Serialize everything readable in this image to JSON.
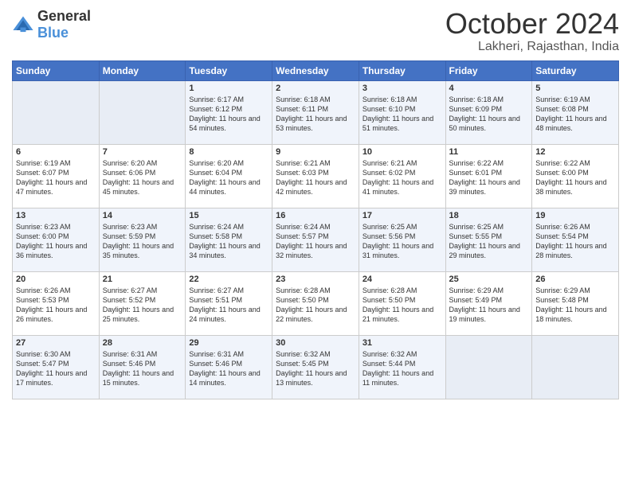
{
  "logo": {
    "general": "General",
    "blue": "Blue"
  },
  "header": {
    "month": "October 2024",
    "location": "Lakheri, Rajasthan, India"
  },
  "weekdays": [
    "Sunday",
    "Monday",
    "Tuesday",
    "Wednesday",
    "Thursday",
    "Friday",
    "Saturday"
  ],
  "weeks": [
    [
      {
        "day": "",
        "sunrise": "",
        "sunset": "",
        "daylight": ""
      },
      {
        "day": "",
        "sunrise": "",
        "sunset": "",
        "daylight": ""
      },
      {
        "day": "1",
        "sunrise": "Sunrise: 6:17 AM",
        "sunset": "Sunset: 6:12 PM",
        "daylight": "Daylight: 11 hours and 54 minutes."
      },
      {
        "day": "2",
        "sunrise": "Sunrise: 6:18 AM",
        "sunset": "Sunset: 6:11 PM",
        "daylight": "Daylight: 11 hours and 53 minutes."
      },
      {
        "day": "3",
        "sunrise": "Sunrise: 6:18 AM",
        "sunset": "Sunset: 6:10 PM",
        "daylight": "Daylight: 11 hours and 51 minutes."
      },
      {
        "day": "4",
        "sunrise": "Sunrise: 6:18 AM",
        "sunset": "Sunset: 6:09 PM",
        "daylight": "Daylight: 11 hours and 50 minutes."
      },
      {
        "day": "5",
        "sunrise": "Sunrise: 6:19 AM",
        "sunset": "Sunset: 6:08 PM",
        "daylight": "Daylight: 11 hours and 48 minutes."
      }
    ],
    [
      {
        "day": "6",
        "sunrise": "Sunrise: 6:19 AM",
        "sunset": "Sunset: 6:07 PM",
        "daylight": "Daylight: 11 hours and 47 minutes."
      },
      {
        "day": "7",
        "sunrise": "Sunrise: 6:20 AM",
        "sunset": "Sunset: 6:06 PM",
        "daylight": "Daylight: 11 hours and 45 minutes."
      },
      {
        "day": "8",
        "sunrise": "Sunrise: 6:20 AM",
        "sunset": "Sunset: 6:04 PM",
        "daylight": "Daylight: 11 hours and 44 minutes."
      },
      {
        "day": "9",
        "sunrise": "Sunrise: 6:21 AM",
        "sunset": "Sunset: 6:03 PM",
        "daylight": "Daylight: 11 hours and 42 minutes."
      },
      {
        "day": "10",
        "sunrise": "Sunrise: 6:21 AM",
        "sunset": "Sunset: 6:02 PM",
        "daylight": "Daylight: 11 hours and 41 minutes."
      },
      {
        "day": "11",
        "sunrise": "Sunrise: 6:22 AM",
        "sunset": "Sunset: 6:01 PM",
        "daylight": "Daylight: 11 hours and 39 minutes."
      },
      {
        "day": "12",
        "sunrise": "Sunrise: 6:22 AM",
        "sunset": "Sunset: 6:00 PM",
        "daylight": "Daylight: 11 hours and 38 minutes."
      }
    ],
    [
      {
        "day": "13",
        "sunrise": "Sunrise: 6:23 AM",
        "sunset": "Sunset: 6:00 PM",
        "daylight": "Daylight: 11 hours and 36 minutes."
      },
      {
        "day": "14",
        "sunrise": "Sunrise: 6:23 AM",
        "sunset": "Sunset: 5:59 PM",
        "daylight": "Daylight: 11 hours and 35 minutes."
      },
      {
        "day": "15",
        "sunrise": "Sunrise: 6:24 AM",
        "sunset": "Sunset: 5:58 PM",
        "daylight": "Daylight: 11 hours and 34 minutes."
      },
      {
        "day": "16",
        "sunrise": "Sunrise: 6:24 AM",
        "sunset": "Sunset: 5:57 PM",
        "daylight": "Daylight: 11 hours and 32 minutes."
      },
      {
        "day": "17",
        "sunrise": "Sunrise: 6:25 AM",
        "sunset": "Sunset: 5:56 PM",
        "daylight": "Daylight: 11 hours and 31 minutes."
      },
      {
        "day": "18",
        "sunrise": "Sunrise: 6:25 AM",
        "sunset": "Sunset: 5:55 PM",
        "daylight": "Daylight: 11 hours and 29 minutes."
      },
      {
        "day": "19",
        "sunrise": "Sunrise: 6:26 AM",
        "sunset": "Sunset: 5:54 PM",
        "daylight": "Daylight: 11 hours and 28 minutes."
      }
    ],
    [
      {
        "day": "20",
        "sunrise": "Sunrise: 6:26 AM",
        "sunset": "Sunset: 5:53 PM",
        "daylight": "Daylight: 11 hours and 26 minutes."
      },
      {
        "day": "21",
        "sunrise": "Sunrise: 6:27 AM",
        "sunset": "Sunset: 5:52 PM",
        "daylight": "Daylight: 11 hours and 25 minutes."
      },
      {
        "day": "22",
        "sunrise": "Sunrise: 6:27 AM",
        "sunset": "Sunset: 5:51 PM",
        "daylight": "Daylight: 11 hours and 24 minutes."
      },
      {
        "day": "23",
        "sunrise": "Sunrise: 6:28 AM",
        "sunset": "Sunset: 5:50 PM",
        "daylight": "Daylight: 11 hours and 22 minutes."
      },
      {
        "day": "24",
        "sunrise": "Sunrise: 6:28 AM",
        "sunset": "Sunset: 5:50 PM",
        "daylight": "Daylight: 11 hours and 21 minutes."
      },
      {
        "day": "25",
        "sunrise": "Sunrise: 6:29 AM",
        "sunset": "Sunset: 5:49 PM",
        "daylight": "Daylight: 11 hours and 19 minutes."
      },
      {
        "day": "26",
        "sunrise": "Sunrise: 6:29 AM",
        "sunset": "Sunset: 5:48 PM",
        "daylight": "Daylight: 11 hours and 18 minutes."
      }
    ],
    [
      {
        "day": "27",
        "sunrise": "Sunrise: 6:30 AM",
        "sunset": "Sunset: 5:47 PM",
        "daylight": "Daylight: 11 hours and 17 minutes."
      },
      {
        "day": "28",
        "sunrise": "Sunrise: 6:31 AM",
        "sunset": "Sunset: 5:46 PM",
        "daylight": "Daylight: 11 hours and 15 minutes."
      },
      {
        "day": "29",
        "sunrise": "Sunrise: 6:31 AM",
        "sunset": "Sunset: 5:46 PM",
        "daylight": "Daylight: 11 hours and 14 minutes."
      },
      {
        "day": "30",
        "sunrise": "Sunrise: 6:32 AM",
        "sunset": "Sunset: 5:45 PM",
        "daylight": "Daylight: 11 hours and 13 minutes."
      },
      {
        "day": "31",
        "sunrise": "Sunrise: 6:32 AM",
        "sunset": "Sunset: 5:44 PM",
        "daylight": "Daylight: 11 hours and 11 minutes."
      },
      {
        "day": "",
        "sunrise": "",
        "sunset": "",
        "daylight": ""
      },
      {
        "day": "",
        "sunrise": "",
        "sunset": "",
        "daylight": ""
      }
    ]
  ]
}
